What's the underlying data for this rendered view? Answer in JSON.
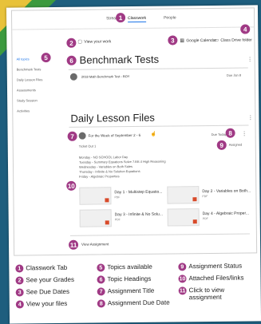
{
  "colors": {
    "accent": "#a03a85",
    "tab_underline": "#1a73e8",
    "file_badge": "#d84a2a"
  },
  "topnav": {
    "tabs": [
      "Stream",
      "Classwork",
      "People"
    ],
    "active": "Classwork"
  },
  "toolbar": {
    "view_work": "View your work",
    "google_calendar": "Google Calendar",
    "drive_folder": "Class Drive folder"
  },
  "sidebar": {
    "items": [
      "All topics",
      "Benchmark Tests",
      "Daily Lesson Files",
      "Assessments",
      "Study Session",
      "Activities"
    ]
  },
  "benchmark": {
    "title": "Benchmark Tests",
    "assignment": "2018 Math Benchmark Test - BOY",
    "due": "Due Jan 8"
  },
  "daily": {
    "title": "Daily Lesson Files",
    "assignment": "For the Week of September 2 - 6",
    "due": "Due Today",
    "status": "Assigned",
    "ticket": "Ticket Out 1",
    "schedule": [
      "Monday - NO SCHOOL Labor Day",
      "Tuesday - Summary Equations Solve 7.EE.4 High Reasoning",
      "Wednesday - Variables on Both Sides",
      "Thursday - Infinite & No Solution Equations",
      "Friday - Algebraic Properties"
    ],
    "files": [
      {
        "name": "Day 1 - Multistep Equatio...",
        "type": "PDF"
      },
      {
        "name": "Day 2 - Variables on Both...",
        "type": "PDF"
      },
      {
        "name": "Day 3 - Infinite & No Solu...",
        "type": "PDF"
      },
      {
        "name": "Day 4 - Algebraic Proper...",
        "type": "PDF"
      }
    ],
    "view_assignment": "View Assignment"
  },
  "legend": [
    {
      "n": "1",
      "text": "Classwork Tab"
    },
    {
      "n": "2",
      "text": "See your Grades"
    },
    {
      "n": "3",
      "text": "See Due Dates"
    },
    {
      "n": "4",
      "text": "View your files"
    },
    {
      "n": "5",
      "text": "Topics available"
    },
    {
      "n": "6",
      "text": "Topic Headings"
    },
    {
      "n": "7",
      "text": "Assignment Title"
    },
    {
      "n": "8",
      "text": "Assignment Due Date"
    },
    {
      "n": "9",
      "text": "Assignment Status"
    },
    {
      "n": "10",
      "text": "Attached Files/links"
    },
    {
      "n": "11",
      "text": "Click to view assignment"
    }
  ],
  "callouts": [
    "1",
    "2",
    "3",
    "4",
    "5",
    "6",
    "7",
    "8",
    "9",
    "10",
    "11"
  ]
}
